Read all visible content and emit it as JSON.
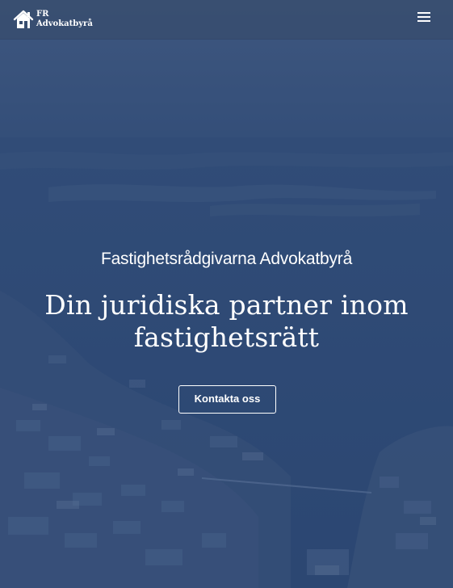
{
  "header": {
    "logo_line1": "FR",
    "logo_line2": "Advokatbyrå",
    "logo_icon": "house-icon",
    "menu_icon": "hamburger-menu-icon"
  },
  "hero": {
    "firm_name": "Fastighetsrådgivarna Advokatbyrå",
    "headline": "Din juridiska partner inom fastighetsrätt",
    "cta_label": "Kontakta oss"
  },
  "colors": {
    "overlay": "#2f4a73",
    "header_bg": "#384e70",
    "text": "#ffffff"
  }
}
